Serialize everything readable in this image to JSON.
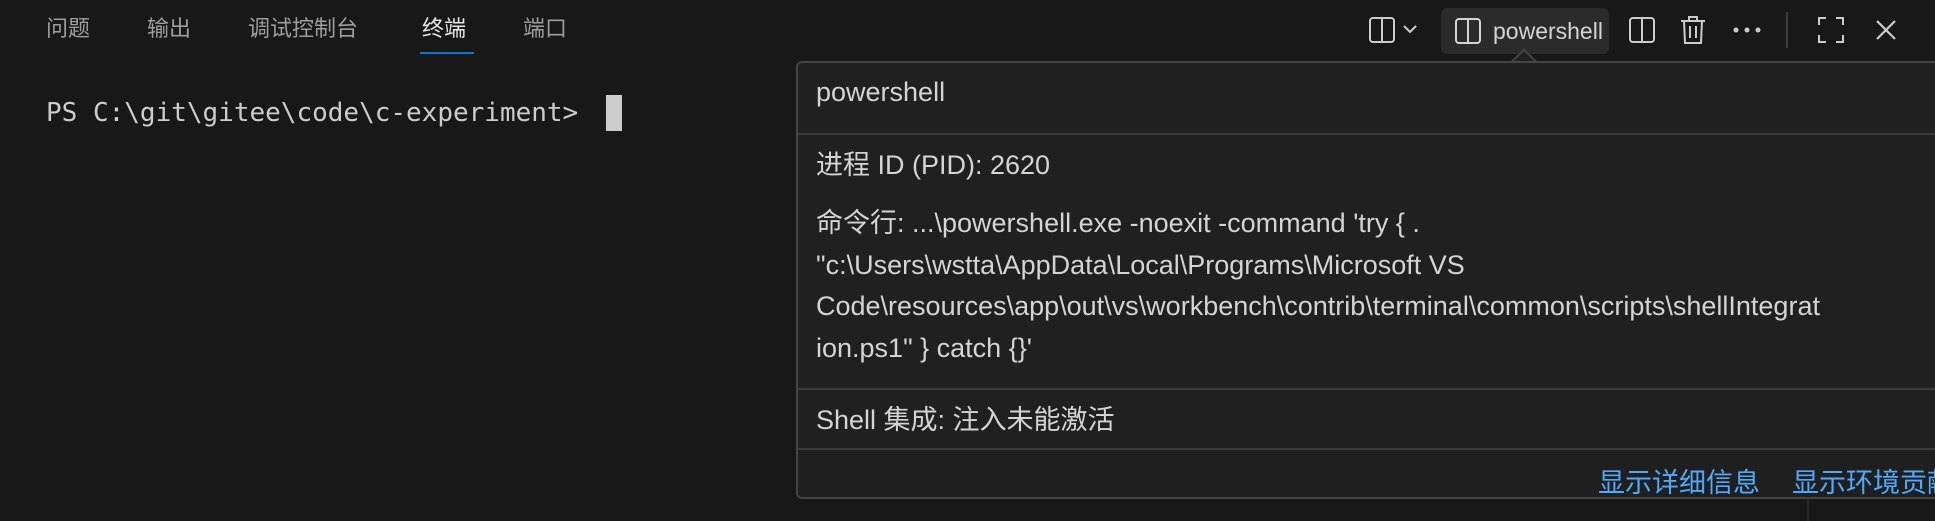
{
  "tabs": [
    {
      "label": "问题"
    },
    {
      "label": "输出"
    },
    {
      "label": "调试控制台"
    },
    {
      "label": "终端"
    },
    {
      "label": "端口"
    }
  ],
  "active_tab": "终端",
  "toolbar": {
    "terminal_name": "powershell",
    "icons": [
      "split-dropdown-icon",
      "terminal-icon",
      "split-terminal-icon",
      "trash-icon",
      "more-icon",
      "maximize-icon",
      "close-icon"
    ]
  },
  "terminal": {
    "prompt": "PS C:\\git\\gitee\\code\\c-experiment>"
  },
  "hover": {
    "title": "powershell",
    "pid": "进程 ID (PID): 2620",
    "cmdline_lines": [
      "命令行: ...\\powershell.exe -noexit -command 'try { .",
      "\"c:\\Users\\wstta\\AppData\\Local\\Programs\\Microsoft VS",
      "Code\\resources\\app\\out\\vs\\workbench\\contrib\\terminal\\common\\scripts\\shellIntegrat",
      "ion.ps1\" } catch {}'"
    ],
    "shell_integration": "Shell 集成: 注入未能激活",
    "links": {
      "show_details": "显示详细信息",
      "show_env": "显示环境贡献"
    }
  },
  "colors": {
    "background": "#181818",
    "accent": "#0078d4",
    "link": "#4daafc"
  }
}
